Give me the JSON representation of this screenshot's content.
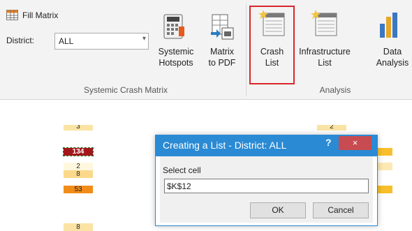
{
  "ribbon": {
    "fill_matrix_label": "Fill Matrix",
    "district_label": "District:",
    "district_value": "ALL",
    "buttons": {
      "systemic_hotspots": [
        "Systemic",
        "Hotspots"
      ],
      "matrix_to_pdf": [
        "Matrix",
        "to PDF"
      ],
      "crash_list": [
        "Crash",
        "List"
      ],
      "infrastructure_list": [
        "Infrastructure",
        "List"
      ],
      "data_analysis": [
        "Data",
        "Analysis"
      ]
    },
    "groups": {
      "systemic": "Systemic Crash Matrix",
      "analysis": "Analysis"
    }
  },
  "sheet": {
    "cells": [
      "3",
      "134",
      "2",
      "8",
      "53",
      "8",
      "2"
    ]
  },
  "dialog": {
    "title": "Creating a List - District: ALL",
    "help": "?",
    "close": "×",
    "prompt": "Select cell",
    "input_value": "$K$12",
    "ok": "OK",
    "cancel": "Cancel"
  },
  "colors": {
    "highlight": "#d9262b",
    "titlebar": "#2a8ad4",
    "close": "#c74b50",
    "cell_dark_red": "#a3171b",
    "cell_orange": "#f28c18",
    "cell_light": "#fbe3a4",
    "cell_gold": "#f8bf2c"
  }
}
